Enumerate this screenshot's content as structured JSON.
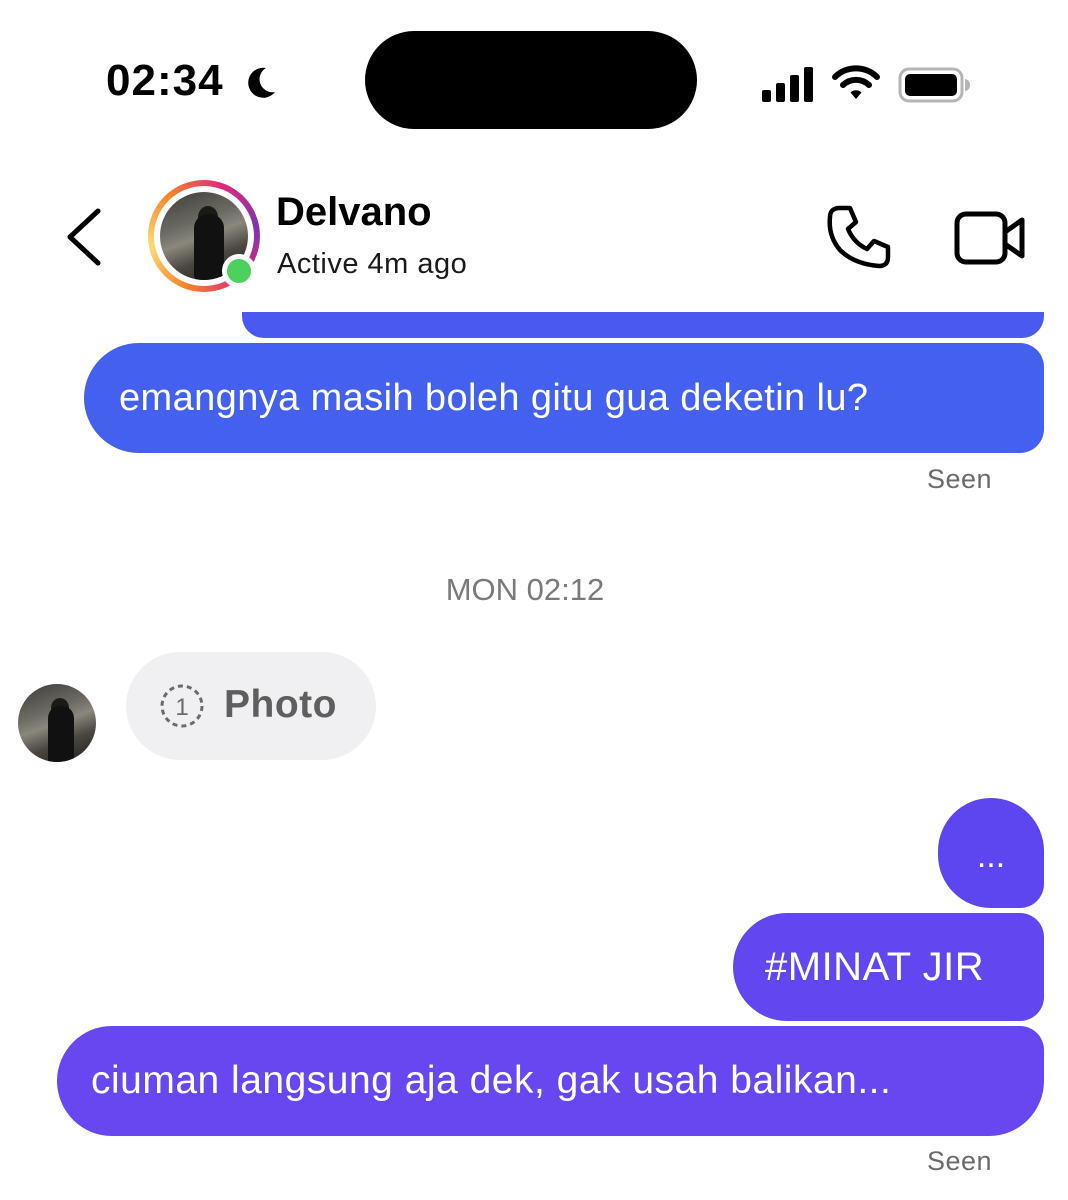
{
  "status_bar": {
    "time": "02:34",
    "moon_icon": "moon-icon",
    "signal_icon": "cellular-signal-icon",
    "wifi_icon": "wifi-icon",
    "battery_icon": "battery-icon"
  },
  "header": {
    "back_icon": "chevron-left-icon",
    "name": "Delvano",
    "status": "Active 4m ago",
    "call_icon": "phone-icon",
    "video_icon": "video-camera-icon"
  },
  "messages": [
    {
      "sender": "me",
      "text": "emangnya masih boleh gitu gua deketin lu?"
    },
    {
      "type": "seen",
      "text": "Seen"
    },
    {
      "type": "date",
      "text": "MON 02:12"
    },
    {
      "sender": "them",
      "type": "photo",
      "icon": "view-once-icon",
      "icon_text": "1",
      "label": "Photo"
    },
    {
      "sender": "me",
      "text": "..."
    },
    {
      "sender": "me",
      "text": "#MINAT JIR"
    },
    {
      "sender": "me",
      "text": "ciuman langsung aja dek, gak usah balikan..."
    },
    {
      "type": "seen",
      "text": "Seen"
    }
  ],
  "colors": {
    "bubble_blue": "#4361ee",
    "bubble_purple": "#6846f0",
    "online": "#4bd15c",
    "meta_text": "#6b6b6b"
  }
}
